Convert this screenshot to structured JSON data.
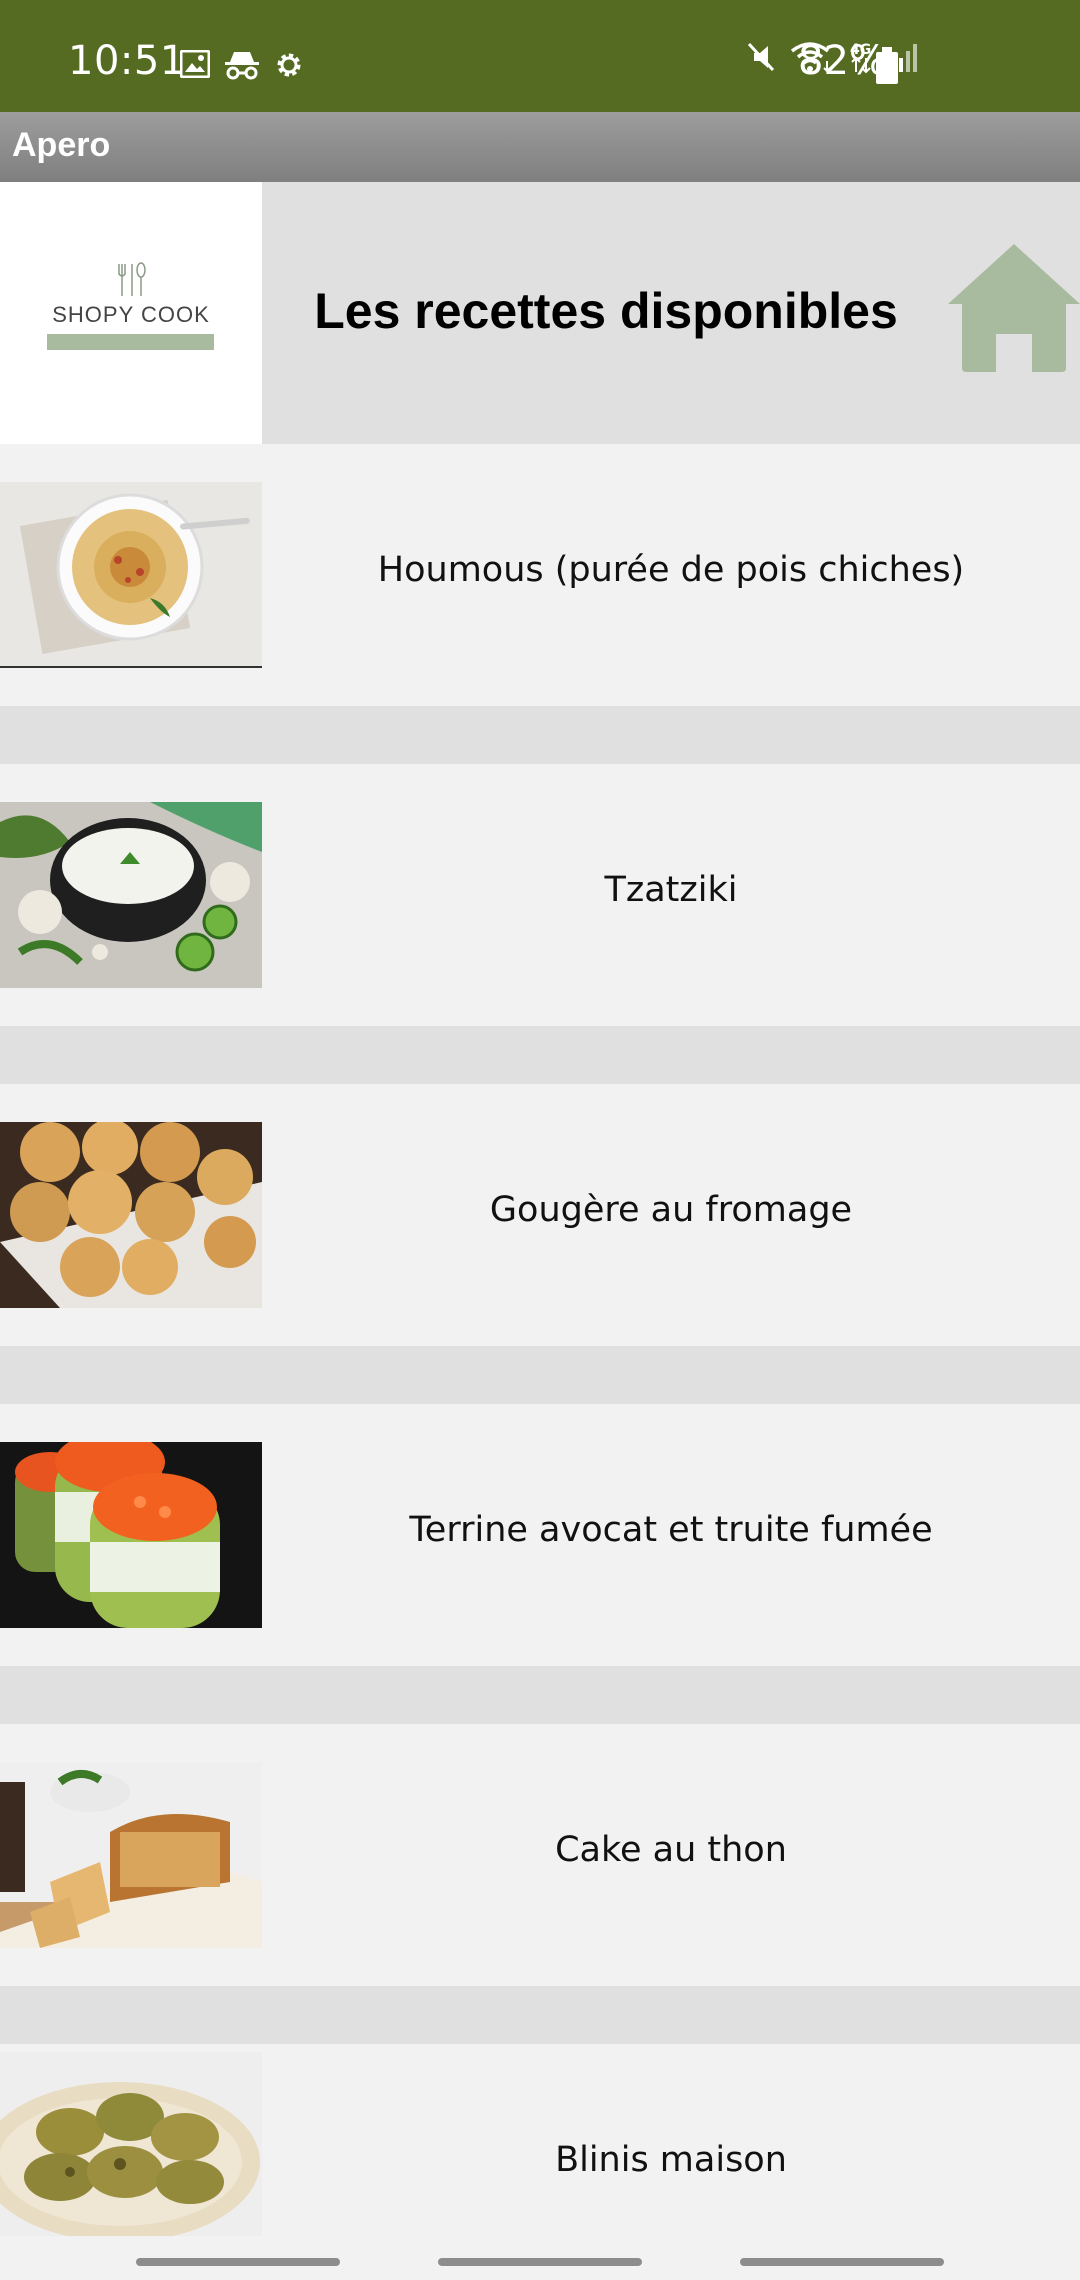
{
  "status_bar": {
    "time": "10:51",
    "battery_text": "82%",
    "icons": [
      "image-icon",
      "incognito-icon",
      "gear-icon",
      "mute-icon",
      "wifi-icon",
      "4g-icon",
      "signal-icon",
      "battery-icon"
    ]
  },
  "app_bar": {
    "title": "Apero"
  },
  "header": {
    "logo_name": "SHOPY COOK",
    "title": "Les recettes disponibles",
    "home_icon": "home-icon"
  },
  "recipes": [
    {
      "label": "Houmous (purée de pois chiches)",
      "thumb": "hummus-image"
    },
    {
      "label": "Tzatziki",
      "thumb": "tzatziki-image"
    },
    {
      "label": "Gougère au fromage",
      "thumb": "gougere-image"
    },
    {
      "label": "Terrine avocat et truite fumée",
      "thumb": "terrine-image"
    },
    {
      "label": "Cake au thon",
      "thumb": "cake-image"
    },
    {
      "label": "Blinis maison",
      "thumb": "blinis-image"
    }
  ],
  "colors": {
    "status_bar": "#556b22",
    "app_bar": "#8e8e8e",
    "header_bg": "#dfe0df",
    "row_bg": "#f2f2f2",
    "home_icon": "#a9bb9f"
  }
}
